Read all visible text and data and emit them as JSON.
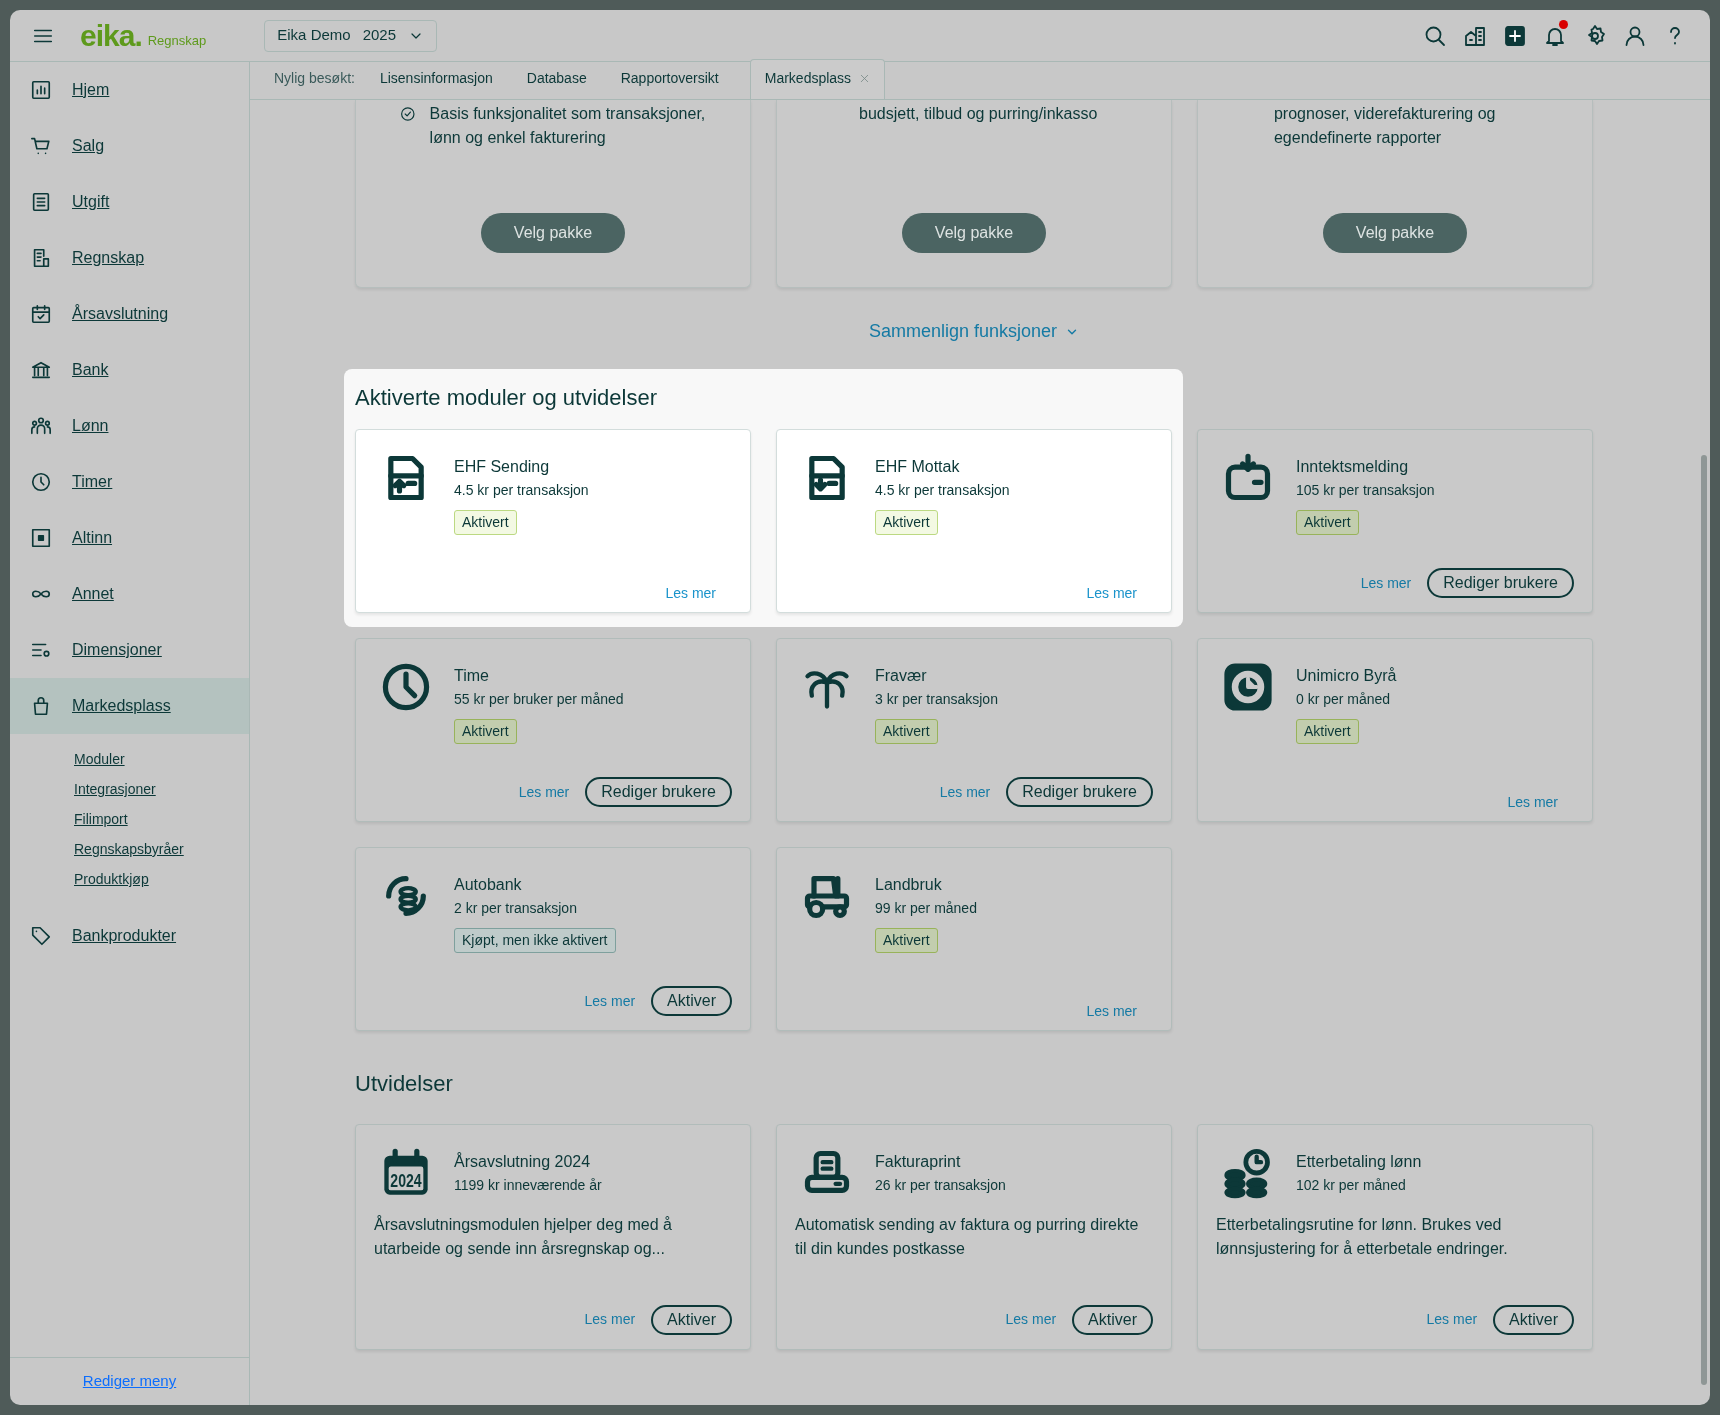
{
  "header": {
    "logo": {
      "brand": "eika.",
      "product": "Regnskap"
    },
    "company_selector": {
      "company": "Eika Demo",
      "year": "2025"
    },
    "notifications_unread": true
  },
  "sidebar": {
    "items": [
      {
        "label": "Hjem",
        "selected": false
      },
      {
        "label": "Salg",
        "selected": false
      },
      {
        "label": "Utgift",
        "selected": false
      },
      {
        "label": "Regnskap",
        "selected": false
      },
      {
        "label": "Årsavslutning",
        "selected": false
      },
      {
        "label": "Bank",
        "selected": false
      },
      {
        "label": "Lønn",
        "selected": false
      },
      {
        "label": "Timer",
        "selected": false
      },
      {
        "label": "Altinn",
        "selected": false
      },
      {
        "label": "Annet",
        "selected": false
      },
      {
        "label": "Dimensjoner",
        "selected": false
      },
      {
        "label": "Markedsplass",
        "selected": true,
        "children": [
          {
            "label": "Moduler"
          },
          {
            "label": "Integrasjoner"
          },
          {
            "label": "Filimport"
          },
          {
            "label": "Regnskapsbyråer"
          },
          {
            "label": "Produktkjøp"
          }
        ]
      },
      {
        "label": "Bankprodukter",
        "selected": false
      }
    ],
    "footer": "Rediger meny"
  },
  "recent": {
    "label": "Nylig besøkt:",
    "tabs": [
      {
        "label": "Lisensinformasjon",
        "selected": false
      },
      {
        "label": "Database",
        "selected": false
      },
      {
        "label": "Rapportoversikt",
        "selected": false
      },
      {
        "label": "Markedsplass",
        "selected": true
      }
    ]
  },
  "plans": [
    {
      "text": "Basis funksjonalitet som transaksjoner, lønn og enkel fakturering",
      "checked": true,
      "button": "Velg pakke"
    },
    {
      "text": "budsjett, tilbud og purring/inkasso",
      "checked": false,
      "button": "Velg pakke"
    },
    {
      "text": "prognoser, viderefakturering og egendefinerte rapporter",
      "checked": false,
      "button": "Velg pakke"
    }
  ],
  "compare_link": "Sammenlign funksjoner",
  "modules": {
    "title": "Aktiverte moduler og utvidelser",
    "items": [
      {
        "name": "EHF Sending",
        "price": "4.5 kr per transaksjon",
        "status": {
          "label": "Aktivert",
          "kind": "active"
        },
        "spotlight": true,
        "link": "Les mer"
      },
      {
        "name": "EHF Mottak",
        "price": "4.5 kr per transaksjon",
        "status": {
          "label": "Aktivert",
          "kind": "active"
        },
        "spotlight": true,
        "link": "Les mer"
      },
      {
        "name": "Inntektsmelding",
        "price": "105 kr per transaksjon",
        "status": {
          "label": "Aktivert",
          "kind": "active"
        },
        "spotlight": false,
        "link": "Les mer",
        "button": "Rediger brukere"
      },
      {
        "name": "Time",
        "price": "55 kr per bruker per måned",
        "status": {
          "label": "Aktivert",
          "kind": "active"
        },
        "spotlight": false,
        "link": "Les mer",
        "button": "Rediger brukere"
      },
      {
        "name": "Fravær",
        "price": "3 kr per transaksjon",
        "status": {
          "label": "Aktivert",
          "kind": "active"
        },
        "spotlight": false,
        "link": "Les mer",
        "button": "Rediger brukere"
      },
      {
        "name": "Unimicro Byrå",
        "price": "0 kr per måned",
        "status": {
          "label": "Aktivert",
          "kind": "active"
        },
        "spotlight": false,
        "link": "Les mer"
      },
      {
        "name": "Autobank",
        "price": "2 kr per transaksjon",
        "status": {
          "label": "Kjøpt, men ikke aktivert",
          "kind": "purchased"
        },
        "spotlight": false,
        "link": "Les mer",
        "button": "Aktiver"
      },
      {
        "name": "Landbruk",
        "price": "99 kr per måned",
        "status": {
          "label": "Aktivert",
          "kind": "active"
        },
        "spotlight": false,
        "link": "Les mer"
      }
    ]
  },
  "extensions": {
    "title": "Utvidelser",
    "items": [
      {
        "name": "Årsavslutning 2024",
        "icon_label": "2024",
        "price": "1199 kr inneværende år",
        "description": "Årsavslutningsmodulen hjelper deg med å utarbeide og sende inn årsregnskap og...",
        "link": "Les mer",
        "button": "Aktiver"
      },
      {
        "name": "Fakturaprint",
        "price": "26 kr per transaksjon",
        "description": "Automatisk sending av faktura og purring direkte til din kundes postkasse",
        "link": "Les mer",
        "button": "Aktiver"
      },
      {
        "name": "Etterbetaling lønn",
        "price": "102 kr per måned",
        "description": "Etterbetalingsrutine for lønn. Brukes ved lønnsjustering for å etterbetale endringer.",
        "link": "Les mer",
        "button": "Aktiver"
      }
    ]
  }
}
